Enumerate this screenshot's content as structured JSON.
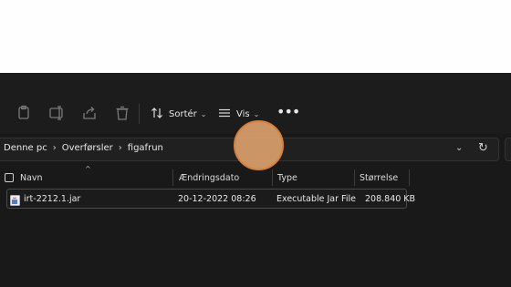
{
  "toolbar": {
    "sort_label": "Sortér",
    "view_label": "Vis",
    "more_label": "•••",
    "icons": [
      "copy-icon",
      "rename-icon",
      "share-icon",
      "delete-icon",
      "sort-icon",
      "view-icon"
    ]
  },
  "breadcrumb": {
    "items": [
      "Denne pc",
      "Overførsler",
      "figafrun"
    ],
    "separator": "›"
  },
  "address": {
    "dropdown_icon": "⌄",
    "refresh_icon": "↻"
  },
  "columns": {
    "name": "Navn",
    "modified": "Ændringsdato",
    "type": "Type",
    "size": "Størrelse"
  },
  "files": [
    {
      "name": "irt-2212.1.jar",
      "modified": "20-12-2022 08:26",
      "type": "Executable Jar File",
      "size": "208.840 KB"
    }
  ],
  "colors": {
    "background": "#191919",
    "highlight_circle": "#db9f6c"
  }
}
